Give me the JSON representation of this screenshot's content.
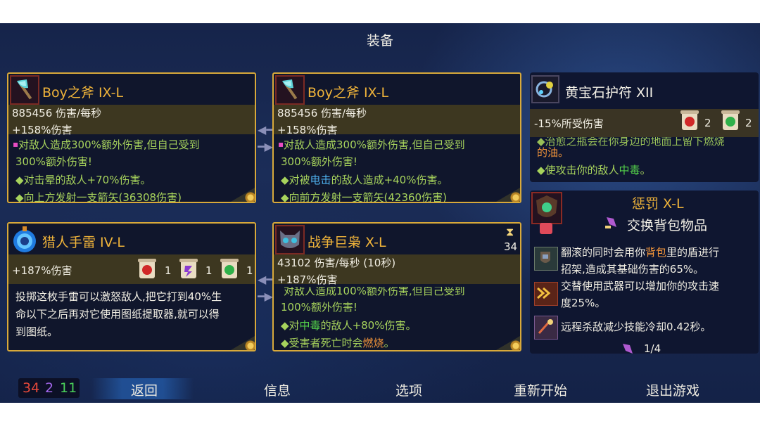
{
  "screen_title": "装备",
  "cell_counts": {
    "red": "34",
    "purple": "2",
    "green": "11"
  },
  "menu": [
    "返回",
    "信息",
    "选项",
    "重新开始",
    "退出游戏"
  ],
  "weapon1": {
    "name": "Boy之斧  IX-L",
    "stat1": "885456 伤害/每秒",
    "stat2": "+158%伤害",
    "line1": "对敌人造成300%额外伤害,但自己受到",
    "line2": "300%额外伤害!",
    "line3": "◆对击晕的敌人+70%伤害。",
    "line4": "◆向上方发射一支箭矢(36308伤害)"
  },
  "weapon2": {
    "name": "Boy之斧  IX-L",
    "stat1": "885456 伤害/每秒",
    "stat2": "+158%伤害",
    "line1": "对敌人造成300%额外伤害,但自己受到",
    "line2": "300%额外伤害!",
    "line3_pre": "◆对被",
    "line3_kw": "电击",
    "line3_post": "的敌人造成+40%伤害。",
    "line4": "◆向前方发射一支箭矢(42360伤害)"
  },
  "skill1": {
    "name": "猎人手雷  IV-L",
    "stat1": "+187%伤害",
    "scrolls": [
      "1",
      "1",
      "1"
    ],
    "desc1": "投掷这枚手雷可以激怒敌人,把它打到40%生",
    "desc2": "命以下之后再对它使用图纸提取器,就可以得",
    "desc3": "到图纸。"
  },
  "skill2": {
    "name": "战争巨枭  X-L",
    "cooldown": "34",
    "stat1": "43102 伤害/每秒 (10秒)",
    "stat2": "+187%伤害",
    "line0": "对敌人造成100%额外伤害,但自己受到",
    "line1": "100%额外伤害!",
    "line2_pre": "◆对",
    "line2_kw": "中毒",
    "line2_post": "的敌人+80%伤害。",
    "line3_pre": "◆受害者死亡时会",
    "line3_kw": "燃烧",
    "line3_post": "。"
  },
  "amulet": {
    "name": "黄宝石护符  XII",
    "stat1": "-15%所受伤害",
    "scrolls": [
      "2",
      "2"
    ],
    "line_hidden": "◆治愈之瓶会在你身边的地面上留下燃烧",
    "line1_kw": "的油。",
    "line2_pre": "◆使攻击你的敌人",
    "line2_kw": "中毒",
    "line2_post": "。"
  },
  "mutations": {
    "punish_name": "惩罚  X-L",
    "swap_label": "交换背包物品",
    "m1_pre": "翻滚的同时会用你",
    "m1_kw": "背包",
    "m1_post": "里的盾进行",
    "m1_line2": "招架,造成其基础伤害的65%。",
    "m2_line1": "交替使用武器可以增加你的攻击速",
    "m2_line2": "度25%。",
    "m3_line1": "远程杀敌减少技能冷却0.42秒。",
    "page": "1/4"
  },
  "colors": {
    "gold": "#d8a93a",
    "item_name": "#f0b43a",
    "effect_green": "#a7d35c",
    "shock_blue": "#4fb3f0",
    "poison_green": "#54d24a",
    "fire_orange": "#f3953a"
  }
}
